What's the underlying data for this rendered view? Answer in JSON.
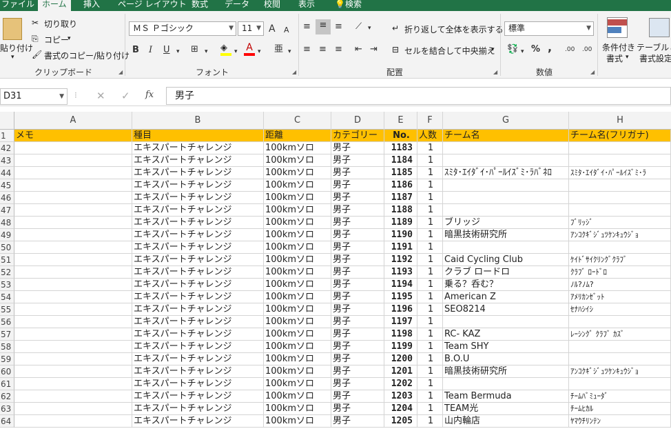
{
  "menu_tabs": [
    {
      "label": "ファイル",
      "active": false
    },
    {
      "label": "ホーム",
      "active": true
    },
    {
      "label": "挿入",
      "active": false
    },
    {
      "label": "ページ レイアウト",
      "active": false
    },
    {
      "label": "数式",
      "active": false
    },
    {
      "label": "データ",
      "active": false
    },
    {
      "label": "校閲",
      "active": false
    },
    {
      "label": "表示",
      "active": false
    },
    {
      "label": "検索",
      "active": false
    }
  ],
  "clipboard": {
    "paste_label": "貼り付け",
    "cut_label": "切り取り",
    "copy_label": "コピー",
    "format_painter_label": "書式のコピー/貼り付け",
    "group_label": "クリップボード"
  },
  "font": {
    "font_name": "ＭＳ Ｐゴシック",
    "font_size": "11",
    "grow_label": "A",
    "shrink_label": "A",
    "bold": "B",
    "italic": "I",
    "underline": "U",
    "group_label": "フォント"
  },
  "alignment": {
    "wrap_label": "折り返して全体を表示する",
    "merge_label": "セルを結合して中央揃え",
    "group_label": "配置"
  },
  "number": {
    "format": "標準",
    "percent": "%",
    "comma": ",",
    "inc_decimal": ".00",
    "dec_decimal": ".00",
    "group_label": "数値"
  },
  "styles": {
    "conditional_label1": "条件付き",
    "conditional_label2": "書式",
    "table_label1": "テーブルとし",
    "table_label2": "書式設定"
  },
  "formula_bar": {
    "name_box": "D31",
    "fx": "fx",
    "value": "男子"
  },
  "columns": [
    "A",
    "B",
    "C",
    "D",
    "E",
    "F",
    "G",
    "H"
  ],
  "header_row": {
    "row_number": "1",
    "cells": [
      "メモ",
      "種目",
      "距離",
      "カテゴリー",
      "No.",
      "人数",
      "チーム名",
      "チーム名(フリガナ)"
    ]
  },
  "rows": [
    {
      "n": "42",
      "event": "エキスパートチャレンジ",
      "dist": "100kmソロ",
      "cat": "男子",
      "no": "1183",
      "num": "1",
      "team": "",
      "kana": ""
    },
    {
      "n": "43",
      "event": "エキスパートチャレンジ",
      "dist": "100kmソロ",
      "cat": "男子",
      "no": "1184",
      "num": "1",
      "team": "",
      "kana": ""
    },
    {
      "n": "44",
      "event": "エキスパートチャレンジ",
      "dist": "100kmソロ",
      "cat": "男子",
      "no": "1185",
      "num": "1",
      "team": "ｽﾐﾀ･ｴｲﾀﾞｲ･ﾊﾟｰﾙｲｽﾞﾐ･ﾗﾊﾞﾈﾛ",
      "kana": "ｽﾐﾀ･ｴｲﾀﾞｲ･ﾊﾟｰﾙｲｽﾞﾐ･ﾗ"
    },
    {
      "n": "45",
      "event": "エキスパートチャレンジ",
      "dist": "100kmソロ",
      "cat": "男子",
      "no": "1186",
      "num": "1",
      "team": "",
      "kana": ""
    },
    {
      "n": "46",
      "event": "エキスパートチャレンジ",
      "dist": "100kmソロ",
      "cat": "男子",
      "no": "1187",
      "num": "1",
      "team": "",
      "kana": ""
    },
    {
      "n": "47",
      "event": "エキスパートチャレンジ",
      "dist": "100kmソロ",
      "cat": "男子",
      "no": "1188",
      "num": "1",
      "team": "",
      "kana": ""
    },
    {
      "n": "48",
      "event": "エキスパートチャレンジ",
      "dist": "100kmソロ",
      "cat": "男子",
      "no": "1189",
      "num": "1",
      "team": "ブリッジ",
      "kana": "ﾌﾞﾘｯｼﾞ"
    },
    {
      "n": "49",
      "event": "エキスパートチャレンジ",
      "dist": "100kmソロ",
      "cat": "男子",
      "no": "1190",
      "num": "1",
      "team": "暗黒技術研究所",
      "kana": "ｱﾝｺｸｷﾞｼﾞｭﾂｹﾝｷｭｳｼﾞｮ"
    },
    {
      "n": "50",
      "event": "エキスパートチャレンジ",
      "dist": "100kmソロ",
      "cat": "男子",
      "no": "1191",
      "num": "1",
      "team": "",
      "kana": ""
    },
    {
      "n": "51",
      "event": "エキスパートチャレンジ",
      "dist": "100kmソロ",
      "cat": "男子",
      "no": "1192",
      "num": "1",
      "team": "Caid Cycling Club",
      "kana": "ｹｲﾄﾞｻｲｸﾘﾝｸﾞｸﾗﾌﾞ"
    },
    {
      "n": "52",
      "event": "エキスパートチャレンジ",
      "dist": "100kmソロ",
      "cat": "男子",
      "no": "1193",
      "num": "1",
      "team": "クラブ ロードロ",
      "kana": "ｸﾗﾌﾞ ﾛｰﾄﾞﾛ"
    },
    {
      "n": "53",
      "event": "エキスパートチャレンジ",
      "dist": "100kmソロ",
      "cat": "男子",
      "no": "1194",
      "num": "1",
      "team": "乗る？呑む？",
      "kana": "ﾉﾙ?ﾉﾑ?"
    },
    {
      "n": "54",
      "event": "エキスパートチャレンジ",
      "dist": "100kmソロ",
      "cat": "男子",
      "no": "1195",
      "num": "1",
      "team": "American Z",
      "kana": "ｱﾒﾘｶﾝｾﾞｯﾄ"
    },
    {
      "n": "55",
      "event": "エキスパートチャレンジ",
      "dist": "100kmソロ",
      "cat": "男子",
      "no": "1196",
      "num": "1",
      "team": "SEO8214",
      "kana": "ｾﾅﾊｼｲｼ"
    },
    {
      "n": "56",
      "event": "エキスパートチャレンジ",
      "dist": "100kmソロ",
      "cat": "男子",
      "no": "1197",
      "num": "1",
      "team": "",
      "kana": ""
    },
    {
      "n": "57",
      "event": "エキスパートチャレンジ",
      "dist": "100kmソロ",
      "cat": "男子",
      "no": "1198",
      "num": "1",
      "team": "RC- KAZ",
      "kana": "ﾚｰｼﾝｸﾞ ｸﾗﾌﾞ ｶｽﾞ"
    },
    {
      "n": "58",
      "event": "エキスパートチャレンジ",
      "dist": "100kmソロ",
      "cat": "男子",
      "no": "1199",
      "num": "1",
      "team": "Team SHY",
      "kana": ""
    },
    {
      "n": "59",
      "event": "エキスパートチャレンジ",
      "dist": "100kmソロ",
      "cat": "男子",
      "no": "1200",
      "num": "1",
      "team": "B.O.U",
      "kana": ""
    },
    {
      "n": "60",
      "event": "エキスパートチャレンジ",
      "dist": "100kmソロ",
      "cat": "男子",
      "no": "1201",
      "num": "1",
      "team": "暗黒技術研究所",
      "kana": "ｱﾝｺｸｷﾞｼﾞｭﾂｹﾝｷｭｳｼﾞｮ"
    },
    {
      "n": "61",
      "event": "エキスパートチャレンジ",
      "dist": "100kmソロ",
      "cat": "男子",
      "no": "1202",
      "num": "1",
      "team": "",
      "kana": ""
    },
    {
      "n": "62",
      "event": "エキスパートチャレンジ",
      "dist": "100kmソロ",
      "cat": "男子",
      "no": "1203",
      "num": "1",
      "team": "Team Bermuda",
      "kana": "ﾁｰﾑﾊﾞﾐｭｰﾀﾞ"
    },
    {
      "n": "63",
      "event": "エキスパートチャレンジ",
      "dist": "100kmソロ",
      "cat": "男子",
      "no": "1204",
      "num": "1",
      "team": "TEAM光",
      "kana": "ﾁｰﾑﾋｶﾙ"
    },
    {
      "n": "64",
      "event": "エキスパートチャレンジ",
      "dist": "100kmソロ",
      "cat": "男子",
      "no": "1205",
      "num": "1",
      "team": "山内輪店",
      "kana": "ﾔﾏｳﾁﾘﾝﾃﾝ"
    }
  ],
  "colors": {
    "ribbon_tab_bar": "#217346",
    "header_fill": "#ffc000",
    "font_highlight": "#ffff00",
    "font_color": "#ff0000"
  }
}
